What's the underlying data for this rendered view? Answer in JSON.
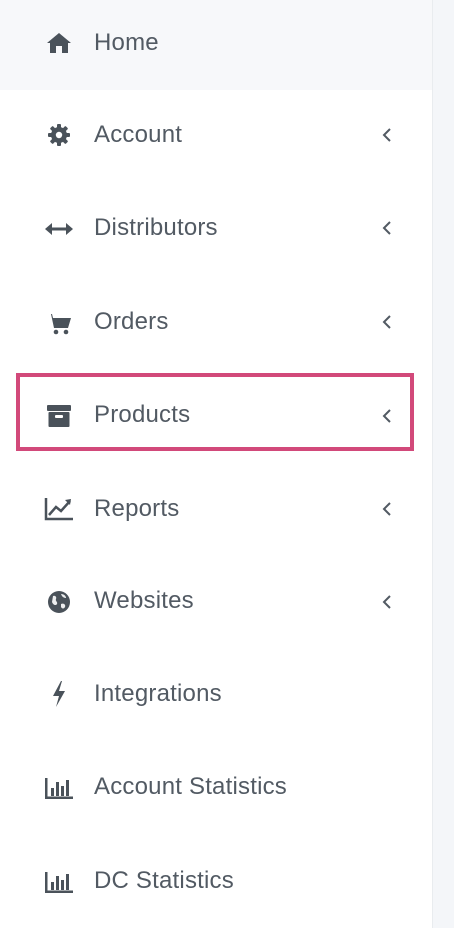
{
  "sidebar": {
    "items": [
      {
        "label": "Home",
        "icon": "home-icon",
        "has_submenu": false,
        "active": true
      },
      {
        "label": "Account",
        "icon": "gear-icon",
        "has_submenu": true
      },
      {
        "label": "Distributors",
        "icon": "horizontal-arrows-icon",
        "has_submenu": true
      },
      {
        "label": "Orders",
        "icon": "shopping-cart-icon",
        "has_submenu": true
      },
      {
        "label": "Products",
        "icon": "archive-box-icon",
        "has_submenu": true,
        "highlighted": true
      },
      {
        "label": "Reports",
        "icon": "line-chart-icon",
        "has_submenu": true
      },
      {
        "label": "Websites",
        "icon": "globe-icon",
        "has_submenu": true
      },
      {
        "label": "Integrations",
        "icon": "lightning-bolt-icon",
        "has_submenu": false
      },
      {
        "label": "Account Statistics",
        "icon": "bar-chart-icon",
        "has_submenu": false
      },
      {
        "label": "DC Statistics",
        "icon": "bar-chart-icon",
        "has_submenu": false
      }
    ]
  },
  "colors": {
    "text": "#525a63",
    "icon": "#4a525a",
    "highlight": "#d2497a",
    "active_background": "#f7f8fa"
  }
}
